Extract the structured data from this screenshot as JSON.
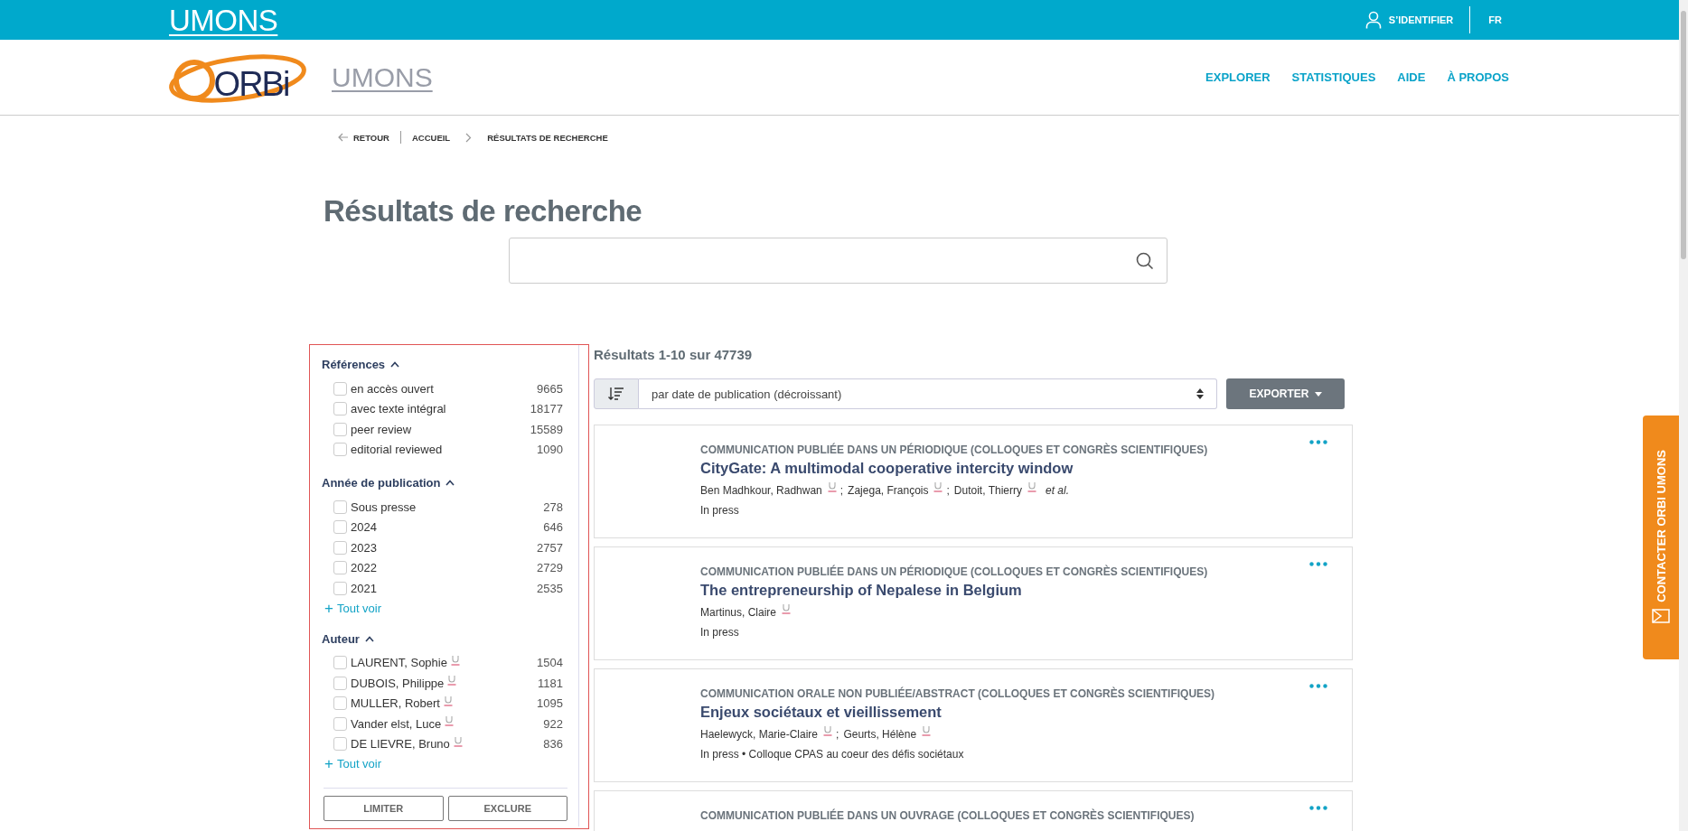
{
  "topbar": {
    "logo": "UMONS",
    "login": "S’IDENTIFIER",
    "language": "FR"
  },
  "header": {
    "logo": "ORBi",
    "sublogo": "UMONS",
    "nav": [
      "EXPLORER",
      "STATISTIQUES",
      "AIDE",
      "À PROPOS"
    ]
  },
  "breadcrumb": {
    "back": "RETOUR",
    "items": [
      "ACCUEIL",
      "RÉSULTATS DE RECHERCHE"
    ]
  },
  "title": "Résultats de recherche",
  "filters": {
    "groups": [
      {
        "title": "Références",
        "expanded": true,
        "items": [
          {
            "label": "en accès ouvert",
            "count": "9665",
            "checked": false,
            "umons_member": false
          },
          {
            "label": "avec texte intégral",
            "count": "18177",
            "checked": false,
            "umons_member": false
          },
          {
            "label": "peer review",
            "count": "15589",
            "checked": false,
            "umons_member": false
          },
          {
            "label": "editorial reviewed",
            "count": "1090",
            "checked": false,
            "umons_member": false
          }
        ]
      },
      {
        "title": "Année de publication",
        "expanded": true,
        "items": [
          {
            "label": "Sous presse",
            "count": "278",
            "checked": false,
            "umons_member": false
          },
          {
            "label": "2024",
            "count": "646",
            "checked": false,
            "umons_member": false
          },
          {
            "label": "2023",
            "count": "2757",
            "checked": false,
            "umons_member": false
          },
          {
            "label": "2022",
            "count": "2729",
            "checked": false,
            "umons_member": false
          },
          {
            "label": "2021",
            "count": "2535",
            "checked": false,
            "umons_member": false
          }
        ],
        "more": "Tout voir"
      },
      {
        "title": "Auteur",
        "expanded": true,
        "items": [
          {
            "label": "LAURENT, Sophie",
            "count": "1504",
            "checked": false,
            "umons_member": true
          },
          {
            "label": "DUBOIS, Philippe",
            "count": "1181",
            "checked": false,
            "umons_member": true
          },
          {
            "label": "MULLER, Robert",
            "count": "1095",
            "checked": false,
            "umons_member": true
          },
          {
            "label": "Vander elst, Luce",
            "count": "922",
            "checked": false,
            "umons_member": true
          },
          {
            "label": "DE LIEVRE, Bruno",
            "count": "836",
            "checked": false,
            "umons_member": true
          }
        ],
        "more": "Tout voir"
      }
    ],
    "more_icon": "+",
    "buttons": [
      "LIMITER",
      "EXCLURE"
    ]
  },
  "results": {
    "author_separator": ";",
    "summary": "Résultats 1-10 sur 47739",
    "sort": "par date de publication (décroissant)",
    "export": "EXPORTER",
    "items": [
      {
        "type": "COMMUNICATION PUBLIÉE DANS UN PÉRIODIQUE (COLLOQUES ET CONGRÈS SCIENTIFIQUES)",
        "title": "CityGate: A multimodal cooperative intercity window",
        "authors": [
          {
            "name": "Ben Madhkour, Radhwan",
            "umons_member": true
          },
          {
            "name": "Zajega, François",
            "umons_member": true
          },
          {
            "name": "Dutoit, Thierry",
            "umons_member": true
          }
        ],
        "more_authors": "et al.",
        "details": "In press"
      },
      {
        "type": "COMMUNICATION PUBLIÉE DANS UN PÉRIODIQUE (COLLOQUES ET CONGRÈS SCIENTIFIQUES)",
        "title": "The entrepreneurship of Nepalese in Belgium",
        "authors": [
          {
            "name": "Martinus, Claire",
            "umons_member": true
          }
        ],
        "details": "In press"
      },
      {
        "type": "COMMUNICATION ORALE NON PUBLIÉE/ABSTRACT (COLLOQUES ET CONGRÈS SCIENTIFIQUES)",
        "title": "Enjeux sociétaux et vieillissement",
        "authors": [
          {
            "name": "Haelewyck, Marie-Claire",
            "umons_member": true
          },
          {
            "name": "Geurts, Hélène",
            "umons_member": true
          }
        ],
        "details": "In press • Colloque CPAS au coeur des défis sociétaux"
      },
      {
        "type": "COMMUNICATION PUBLIÉE DANS UN OUVRAGE (COLLOQUES ET CONGRÈS SCIENTIFIQUES)"
      }
    ]
  },
  "contact_tab": "CONTACTER ORBI UMONS"
}
